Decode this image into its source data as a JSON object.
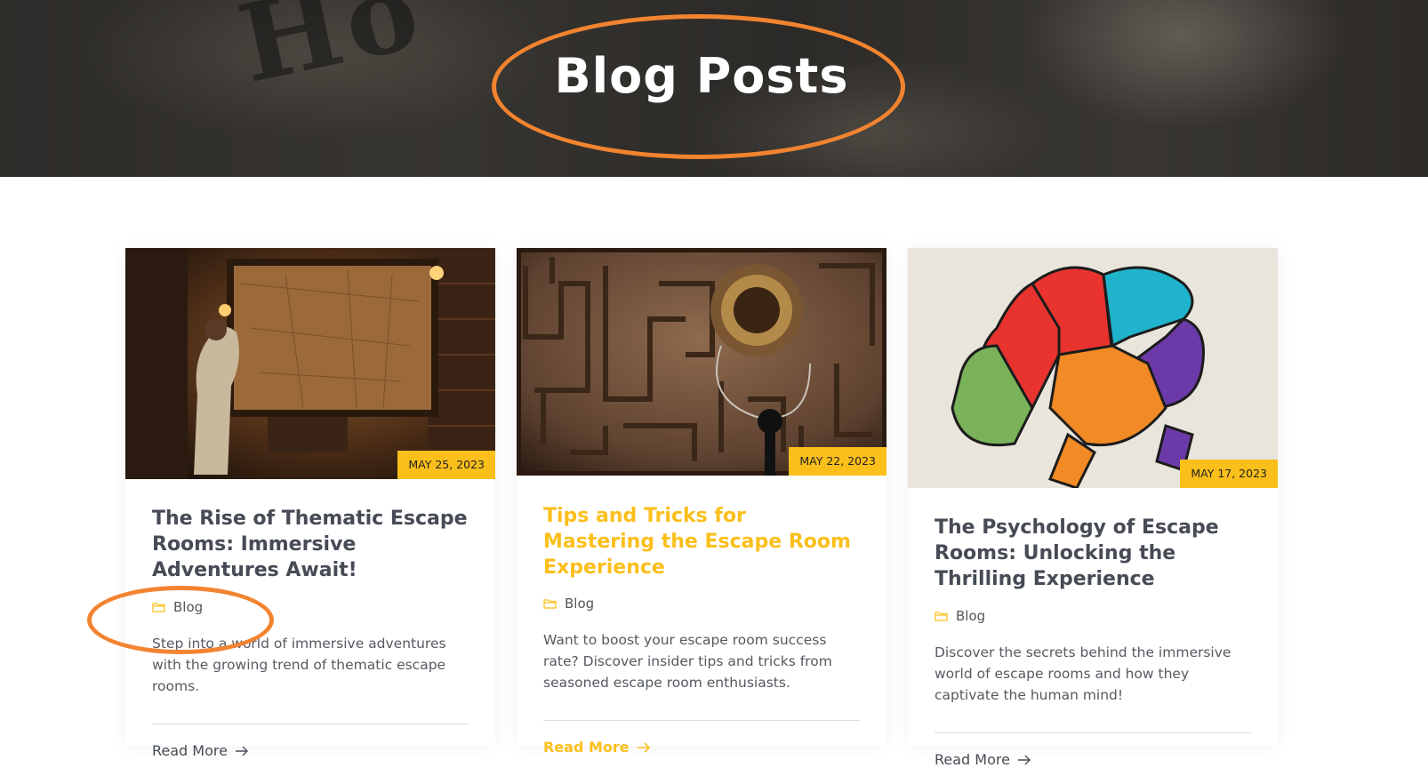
{
  "hero": {
    "title": "Blog Posts"
  },
  "posts": [
    {
      "date": "MAY 25, 2023",
      "title": "The Rise of Thematic Escape Rooms: Immersive Adventures Await!",
      "category": "Blog",
      "excerpt": "Step into a world of immersive adventures with the growing trend of thematic escape rooms.",
      "read_more": "Read More",
      "image": "escape-room-map-photo"
    },
    {
      "date": "MAY 22, 2023",
      "title": "Tips and Tricks for Mastering the Escape Room Experience",
      "category": "Blog",
      "excerpt": "Want to boost your escape room success rate? Discover insider tips and tricks from seasoned escape room enthusiasts.",
      "read_more": "Read More",
      "image": "maze-puzzle-photo"
    },
    {
      "date": "MAY 17, 2023",
      "title": "The Psychology of Escape Rooms: Unlocking the Thrilling Experience",
      "category": "Blog",
      "excerpt": "Discover the secrets behind the immersive world of escape rooms and how they captivate the human mind!",
      "read_more": "Read More",
      "image": "brain-puzzle-photo"
    }
  ],
  "colors": {
    "accent": "#fbbf1b",
    "annotation": "#f28430",
    "heading": "#464b55"
  }
}
